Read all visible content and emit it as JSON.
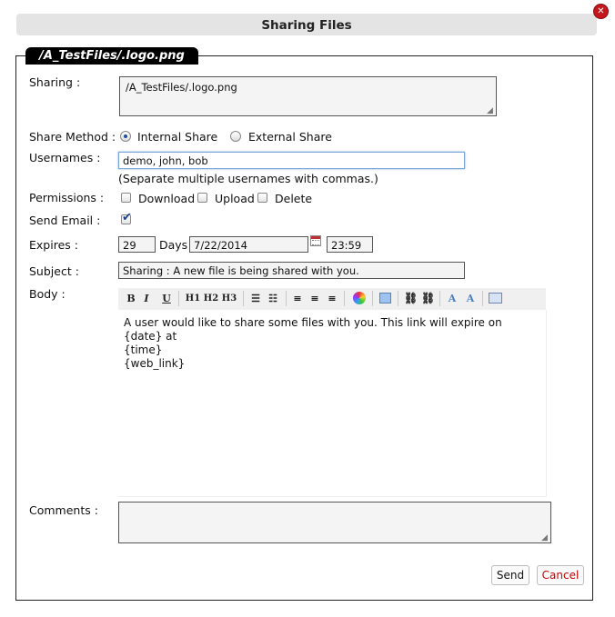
{
  "dialog": {
    "title": "Sharing Files",
    "close_glyph": "✕"
  },
  "file_tab": "/A_TestFiles/.logo.png",
  "sharing": {
    "label": "Sharing :",
    "value": "/A_TestFiles/.logo.png"
  },
  "share_method": {
    "label": "Share Method :",
    "options": [
      {
        "label": "Internal Share",
        "selected": true
      },
      {
        "label": "External Share",
        "selected": false
      }
    ]
  },
  "usernames": {
    "label": "Usernames :",
    "value": "demo, john, bob",
    "hint": "(Separate multiple usernames with commas.)"
  },
  "permissions": {
    "label": "Permissions :",
    "options": [
      "Download",
      "Upload",
      "Delete"
    ]
  },
  "send_email": {
    "label": "Send Email :",
    "checked": true
  },
  "expires": {
    "label": "Expires :",
    "days_value": "29",
    "days_label": "Days",
    "date_value": "7/22/2014",
    "time_value": "23:59"
  },
  "subject": {
    "label": "Subject :",
    "value": "Sharing : A new file is being shared with you."
  },
  "body": {
    "label": "Body :",
    "toolbar": {
      "bold": "B",
      "italic": "I",
      "underline": "U",
      "h1": "H1",
      "h2": "H2",
      "h3": "H3"
    },
    "lines": [
      "A user would like to share some files with you. This link will expire on {date} at",
      "{time}",
      "{web_link}"
    ]
  },
  "comments": {
    "label": "Comments :",
    "value": ""
  },
  "buttons": {
    "send": "Send",
    "cancel": "Cancel"
  },
  "colors": {
    "cancel_text": "#cc0000",
    "tab_bg": "#000000",
    "close_bg": "#c4161c"
  }
}
